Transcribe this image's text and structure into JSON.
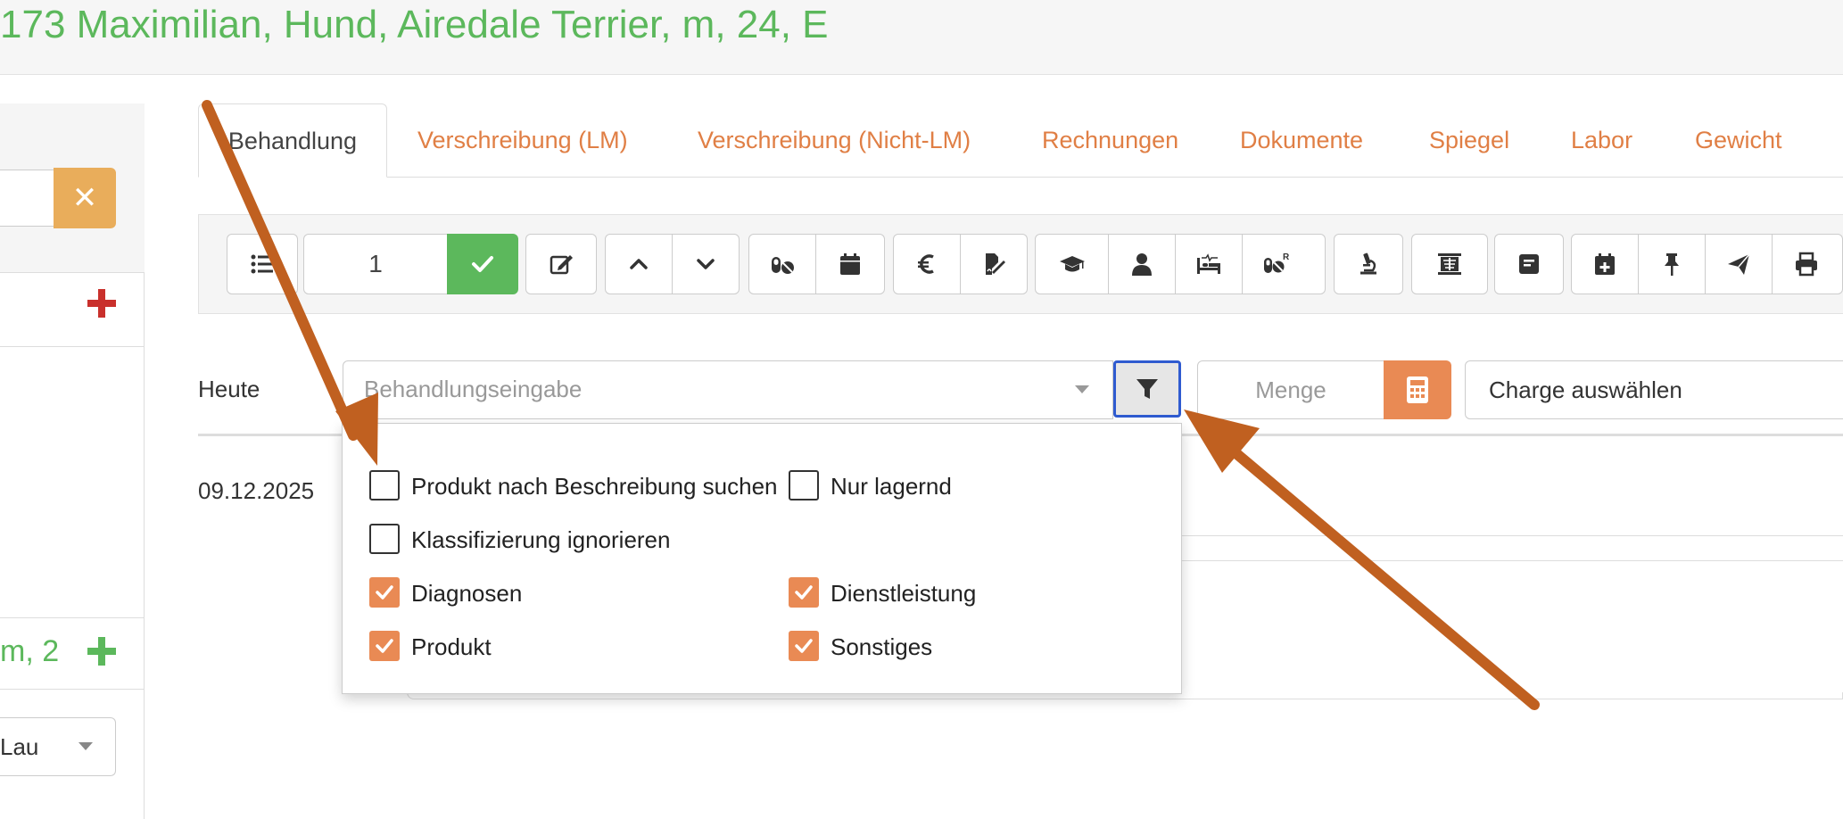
{
  "header": {
    "patient_title": "173 Maximilian, Hund, Airedale Terrier, m, 24, E"
  },
  "left_panel": {
    "green_text": "m, 2",
    "select_value": "Lau",
    "clear_icon": "close-icon",
    "add_icon_red": "plus-icon",
    "add_icon_green": "plus-icon"
  },
  "tabs": [
    {
      "label": "Behandlung",
      "active": true
    },
    {
      "label": "Verschreibung (LM)"
    },
    {
      "label": "Verschreibung (Nicht-LM)"
    },
    {
      "label": "Rechnungen"
    },
    {
      "label": "Dokumente"
    },
    {
      "label": "Spiegel"
    },
    {
      "label": "Labor"
    },
    {
      "label": "Gewicht"
    }
  ],
  "toolbar": {
    "quantity_value": "1",
    "icons": [
      "list-icon",
      "check-icon",
      "edit-icon",
      "chevron-up-icon",
      "chevron-down-icon",
      "pills-icon",
      "calendar-icon",
      "euro-icon",
      "signature-icon",
      "graduation-cap-icon",
      "user-icon",
      "hospital-bed-icon",
      "prescription-pills-icon",
      "microscope-icon",
      "xray-icon",
      "note-icon",
      "calendar-plus-icon",
      "pin-icon",
      "send-icon",
      "print-icon"
    ],
    "prescription_superscript": "R"
  },
  "input_row": {
    "label": "Heute",
    "treatment_placeholder": "Behandlungseingabe",
    "filter_icon": "filter-icon",
    "amount_placeholder": "Menge",
    "calculator_icon": "calculator-icon",
    "batch_select": "Charge auswählen"
  },
  "entry": {
    "date": "09.12.2025"
  },
  "filter_dropdown": {
    "options": [
      {
        "label": "Produkt nach Beschreibung suchen",
        "checked": false
      },
      {
        "label": "Nur lagernd",
        "checked": false
      },
      {
        "label": "Klassifizierung ignorieren",
        "checked": false
      },
      {
        "label": "Diagnosen",
        "checked": true
      },
      {
        "label": "Dienstleistung",
        "checked": true
      },
      {
        "label": "Produkt",
        "checked": true
      },
      {
        "label": "Sonstiges",
        "checked": true
      }
    ]
  },
  "colors": {
    "accent_orange": "#e98a54",
    "success_green": "#5cb85c",
    "danger_red": "#c9302c",
    "focus_blue": "#2f5bd0",
    "annotation_arrow": "#c06020"
  }
}
